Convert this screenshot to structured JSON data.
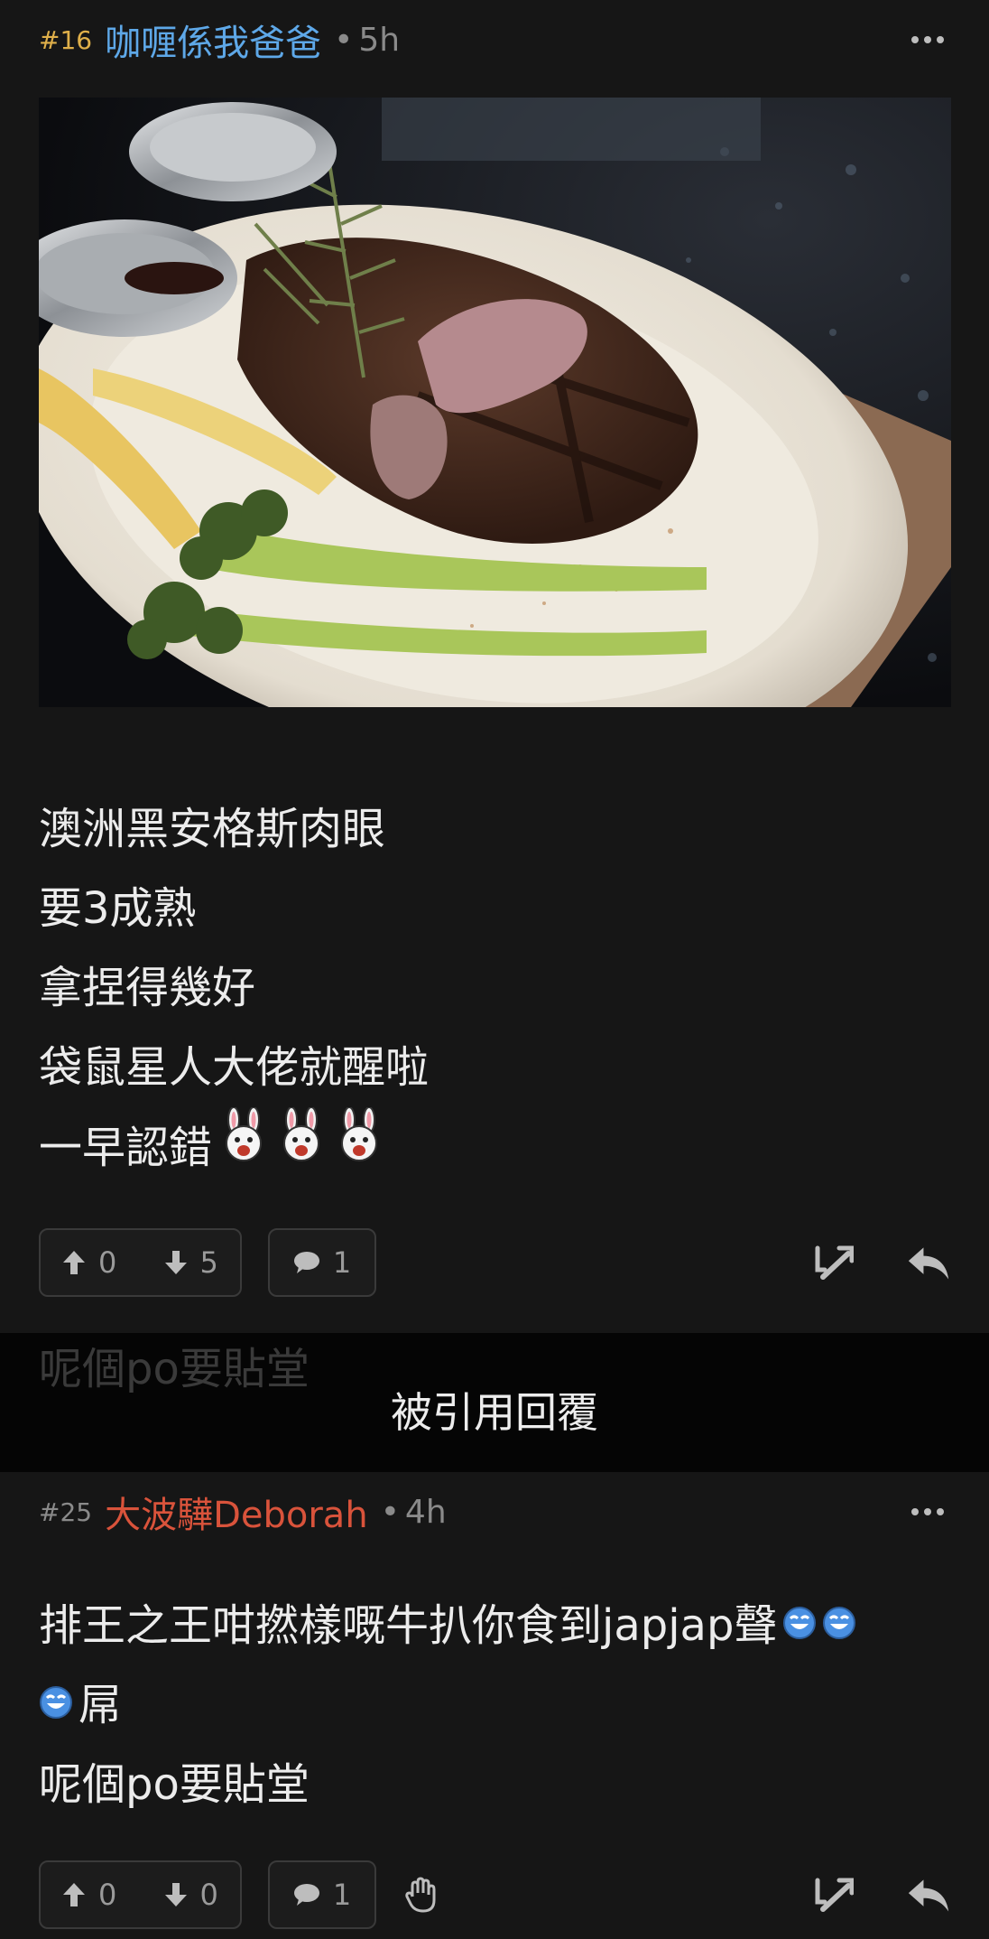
{
  "post16": {
    "floor": "#16",
    "author": "咖喱係我爸爸",
    "dot": "•",
    "time": "5h",
    "lines": [
      "澳洲黑安格斯肉眼",
      "要3成熟",
      "拿捏得幾好",
      "袋鼠星人大佬就醒啦",
      "一早認錯"
    ],
    "upvotes": "0",
    "downvotes": "5",
    "comments": "1"
  },
  "quote_banner": {
    "label": "被引用回覆",
    "ghost_text": "呢個po要貼堂"
  },
  "post25": {
    "floor": "#25",
    "author": "大波驊Deborah",
    "dot": "•",
    "time": "4h",
    "line1": "排王之王咁撚樣嘅牛扒你食到japjap聲",
    "line2": "屌",
    "line3": "呢個po要貼堂",
    "upvotes": "0",
    "downvotes": "0",
    "comments": "1"
  },
  "colors": {
    "background": "#161616",
    "floor16": "#e0b04a",
    "author16": "#5ea8e8",
    "author25": "#d9533b",
    "floor25": "#8a8a8a",
    "banner": "#050505"
  },
  "icons": [
    "more-icon",
    "upvote-arrow-icon",
    "downvote-arrow-icon",
    "comment-bubble-icon",
    "quote-reply-icon",
    "reply-arrow-icon",
    "rabbit-emoji-icon",
    "laughing-emoji-icon",
    "wave-hand-icon"
  ]
}
